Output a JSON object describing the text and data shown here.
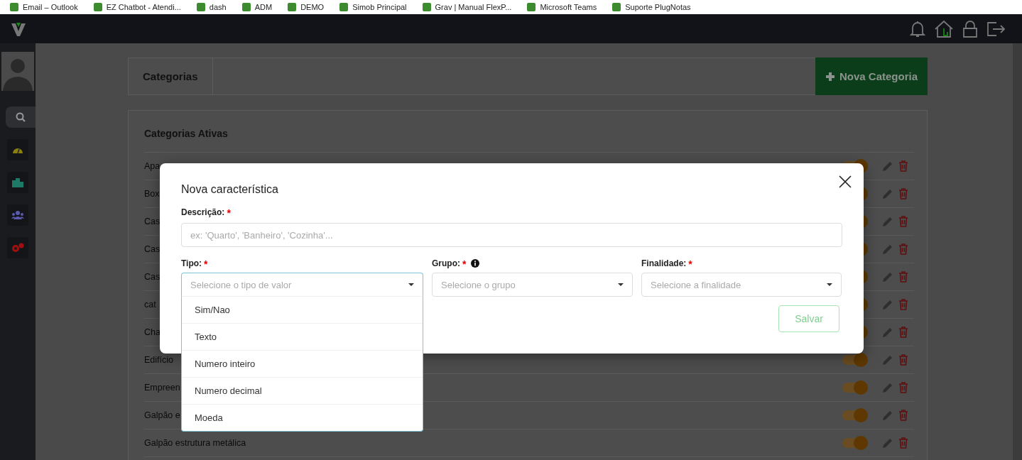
{
  "bookmarks": [
    {
      "label": "Email – Outlook"
    },
    {
      "label": "EZ Chatbot - Atendi..."
    },
    {
      "label": "dash"
    },
    {
      "label": "ADM"
    },
    {
      "label": "DEMO"
    },
    {
      "label": "Simob Principal"
    },
    {
      "label": "Grav | Manual FlexP..."
    },
    {
      "label": "Microsoft Teams"
    },
    {
      "label": "Suporte PlugNotas"
    }
  ],
  "header": {
    "title": "Categorias",
    "button": "Nova Categoria"
  },
  "list": {
    "title": "Categorias Ativas",
    "rows": [
      {
        "name": "Apa",
        "on": true
      },
      {
        "name": "Box",
        "on": true
      },
      {
        "name": "Cas",
        "on": true
      },
      {
        "name": "Cas",
        "on": true
      },
      {
        "name": "Cas",
        "on": true
      },
      {
        "name": "cat",
        "on": true
      },
      {
        "name": "Cha",
        "on": true
      },
      {
        "name": "Edifício",
        "on": true
      },
      {
        "name": "Empreen",
        "on": true
      },
      {
        "name": "Galpão e",
        "on": true
      },
      {
        "name": "Galpão estrutura metálica",
        "on": true
      }
    ]
  },
  "modal": {
    "title": "Nova característica",
    "description": {
      "label": "Descrição:",
      "required_mark": "*",
      "placeholder": "ex: 'Quarto', 'Banheiro', 'Cozinha'..."
    },
    "selects": [
      {
        "label": "Tipo:",
        "required_mark": "*",
        "info": false,
        "placeholder": "Selecione o tipo de valor",
        "open": true
      },
      {
        "label": "Grupo:",
        "required_mark": "*",
        "info": true,
        "placeholder": "Selecione o grupo",
        "open": false
      },
      {
        "label": "Finalidade:",
        "required_mark": "*",
        "info": false,
        "placeholder": "Selecione a finalidade",
        "open": false
      }
    ],
    "options": [
      "Sim/Nao",
      "Texto",
      "Numero inteiro",
      "Numero decimal",
      "Moeda"
    ],
    "save": {
      "label": "Salvar",
      "disabled": true
    }
  }
}
